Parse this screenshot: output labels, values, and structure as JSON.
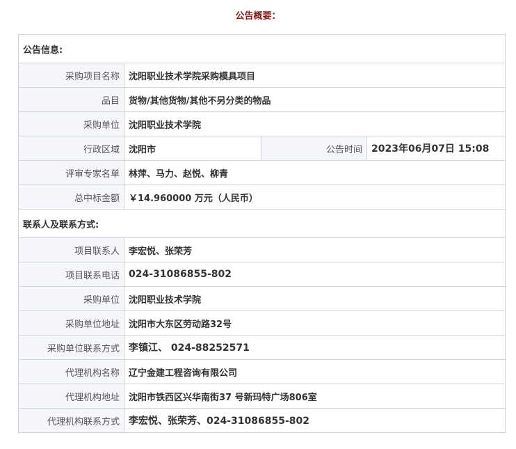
{
  "page_title": "公告概要：",
  "sections": {
    "notice_info": {
      "heading": "公告信息:",
      "project_name": {
        "label": "采购项目名称",
        "value": "沈阳职业技术学院采购模具项目"
      },
      "category": {
        "label": "品目",
        "value": "货物/其他货物/其他不另分类的物品"
      },
      "purchaser": {
        "label": "采购单位",
        "value": "沈阳职业技术学院"
      },
      "region": {
        "label": "行政区域",
        "value": "沈阳市"
      },
      "publish_time": {
        "label": "公告时间",
        "value": "2023年06月07日 15:08"
      },
      "experts": {
        "label": "评审专家名单",
        "value": "林萍、马力、赵悦、柳青"
      },
      "total_amount": {
        "label": "总中标金额",
        "value": "￥14.960000 万元（人民币）"
      }
    },
    "contacts": {
      "heading": "联系人及联系方式:",
      "project_contact": {
        "label": "项目联系人",
        "value": "李宏悦、张荣芳"
      },
      "project_phone": {
        "label": "项目联系电话",
        "value": "024-31086855-802"
      },
      "purchaser": {
        "label": "采购单位",
        "value": "沈阳职业技术学院"
      },
      "purchaser_address": {
        "label": "采购单位地址",
        "value": "沈阳市大东区劳动路32号"
      },
      "purchaser_contact": {
        "label": "采购单位联系方式",
        "value": "李镇江、 024-88252571"
      },
      "agency_name": {
        "label": "代理机构名称",
        "value": "辽宁金建工程咨询有限公司"
      },
      "agency_address": {
        "label": "代理机构地址",
        "value": "沈阳市铁西区兴华南街37 号新玛特广场806室"
      },
      "agency_contact": {
        "label": "代理机构联系方式",
        "value": "李宏悦、张荣芳、024-31086855-802"
      }
    }
  }
}
